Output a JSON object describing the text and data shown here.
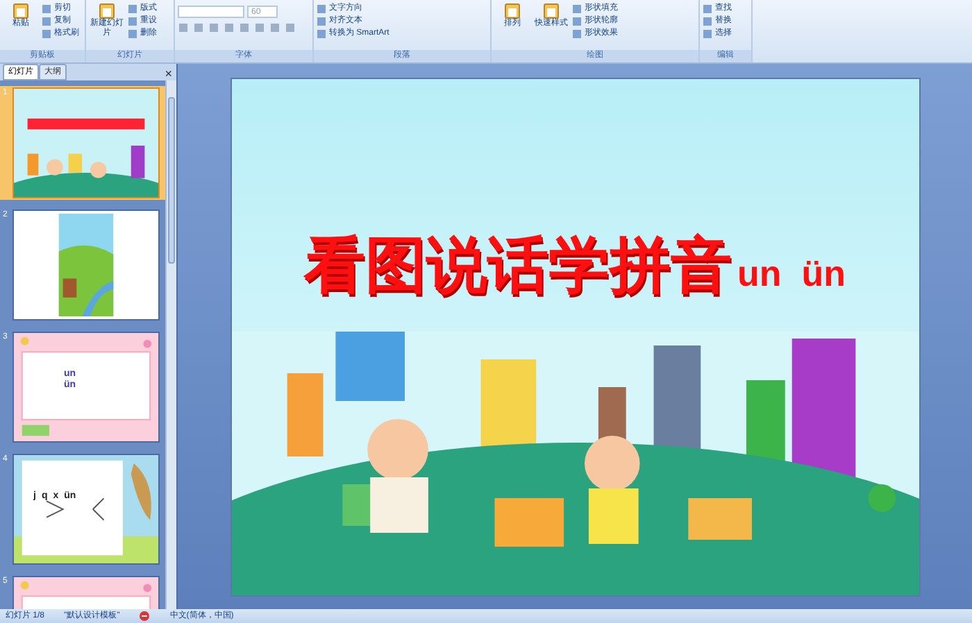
{
  "ribbon": {
    "groups": [
      {
        "label": "剪贴板",
        "large": [
          "粘贴"
        ],
        "small": [
          "剪切",
          "复制",
          "格式刷"
        ]
      },
      {
        "label": "幻灯片",
        "large": [
          "新建幻灯片"
        ],
        "small": [
          "版式",
          "重设",
          "删除"
        ]
      },
      {
        "label": "字体",
        "font_size": "60"
      },
      {
        "label": "段落",
        "small": [
          "文字方向",
          "对齐文本",
          "转换为 SmartArt"
        ]
      },
      {
        "label": "绘图",
        "large": [
          "排列",
          "快速样式"
        ],
        "small": [
          "形状填充",
          "形状轮廓",
          "形状效果"
        ]
      },
      {
        "label": "编辑",
        "small": [
          "查找",
          "替换",
          "选择"
        ]
      }
    ]
  },
  "panel": {
    "tabs": [
      {
        "label": "幻灯片",
        "selected": true
      },
      {
        "label": "大纲",
        "selected": false
      }
    ],
    "close": "×",
    "slides": [
      {
        "number": "1",
        "selected": true,
        "kind": "title"
      },
      {
        "number": "2",
        "selected": false,
        "kind": "landscape"
      },
      {
        "number": "3",
        "selected": false,
        "kind": "pink",
        "texts": [
          "un",
          "ün"
        ]
      },
      {
        "number": "4",
        "selected": false,
        "kind": "diagram",
        "texts": [
          "j",
          "q",
          "x",
          "ün"
        ]
      },
      {
        "number": "5",
        "selected": false,
        "kind": "pink"
      }
    ]
  },
  "slide": {
    "title": "看图说话学拼音",
    "title_suffix": "un  ün"
  },
  "status_bar": {
    "slide": "幻灯片 1/8",
    "theme": "\"默认设计模板\"",
    "language": "中文(简体，中国)"
  }
}
